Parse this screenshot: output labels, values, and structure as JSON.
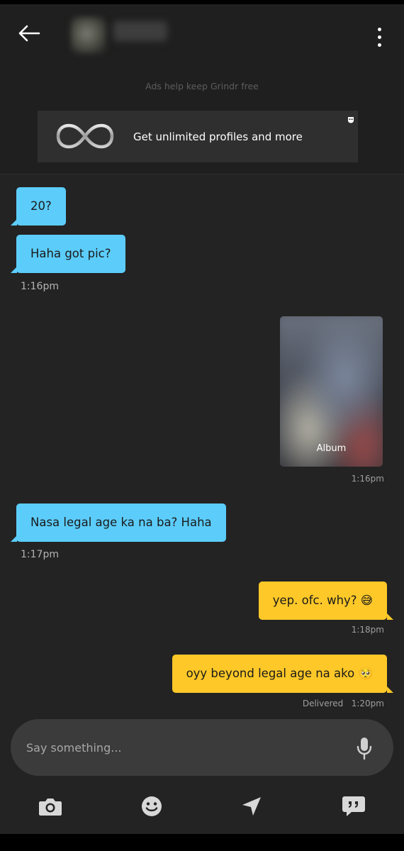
{
  "header": {
    "ads_note": "Ads help keep Grindr free",
    "ad_banner_text": "Get unlimited profiles and more"
  },
  "messages": [
    {
      "direction": "in",
      "text": "20?"
    },
    {
      "direction": "in",
      "text": "Haha got pic?"
    },
    {
      "direction": "in_time",
      "text": "1:16pm"
    },
    {
      "direction": "out_album",
      "label": "Album",
      "time": "1:16pm"
    },
    {
      "direction": "in",
      "text": "Nasa legal age ka na ba? Haha",
      "time": "1:17pm"
    },
    {
      "direction": "out",
      "text": "yep. ofc. why? 😅",
      "time": "1:18pm"
    },
    {
      "direction": "out",
      "text": "oyy beyond legal age na ako 🥺",
      "status": "Delivered",
      "time": "1:20pm"
    }
  ],
  "input": {
    "placeholder": "Say something..."
  },
  "icons": {
    "back": "arrow-left-icon",
    "menu": "more-vertical-icon",
    "ad_logo": "infinity-icon",
    "ad_mask": "grindr-mask-icon",
    "mic": "microphone-icon",
    "camera": "camera-icon",
    "emoji": "smiley-icon",
    "location": "location-arrow-icon",
    "saved_phrases": "quote-bubble-icon"
  },
  "colors": {
    "incoming_bubble": "#5ccdfb",
    "outgoing_bubble": "#fdc828",
    "background": "#232323",
    "header_bg": "#1f1f1f",
    "input_bg": "#3b3b3b"
  }
}
